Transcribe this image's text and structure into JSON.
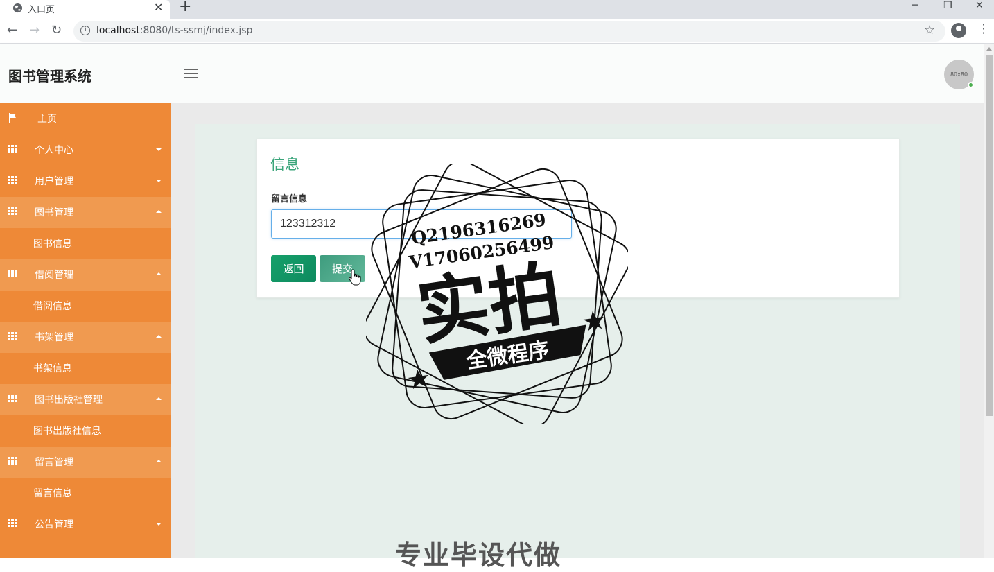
{
  "browser": {
    "tab_title": "入口页",
    "tab_close": "✕",
    "new_tab": "+",
    "url_host": "localhost",
    "url_rest": ":8080/ts-ssmj/index.jsp",
    "win_min": "─",
    "win_restore": "❐",
    "win_close": "✕"
  },
  "header": {
    "title": "图书管理系统",
    "avatar_text": "80x80"
  },
  "sidebar": {
    "items": [
      {
        "label": "主页",
        "icon": "flag-icon"
      },
      {
        "label": "个人中心",
        "icon": "grid-icon",
        "state": "collapsed"
      },
      {
        "label": "用户管理",
        "icon": "grid-icon",
        "state": "collapsed"
      },
      {
        "label": "图书管理",
        "icon": "grid-icon",
        "state": "expanded"
      },
      {
        "label": "图书信息",
        "sub": true
      },
      {
        "label": "借阅管理",
        "icon": "grid-icon",
        "state": "expanded"
      },
      {
        "label": "借阅信息",
        "sub": true
      },
      {
        "label": "书架管理",
        "icon": "grid-icon",
        "state": "expanded"
      },
      {
        "label": "书架信息",
        "sub": true
      },
      {
        "label": "图书出版社管理",
        "icon": "grid-icon",
        "state": "expanded"
      },
      {
        "label": "图书出版社信息",
        "sub": true
      },
      {
        "label": "留言管理",
        "icon": "grid-icon",
        "state": "expanded"
      },
      {
        "label": "留言信息",
        "sub": true
      },
      {
        "label": "公告管理",
        "icon": "grid-icon",
        "state": "collapsed"
      }
    ]
  },
  "form": {
    "title": "信息",
    "field_label": "留言信息",
    "field_value": "123312312",
    "back_label": "返回",
    "submit_label": "提交"
  },
  "watermark": {
    "line1": "Q2196316269",
    "line2": "V17060256499",
    "big": "实拍",
    "ribbon": "全微程序",
    "bottom": "专业毕设代做"
  },
  "colors": {
    "sidebar": "#ee8937",
    "sidebar_open": "#f09a50",
    "accent": "#3aa57a",
    "button_back": "#11935f",
    "button_submit": "#4fab8c"
  }
}
